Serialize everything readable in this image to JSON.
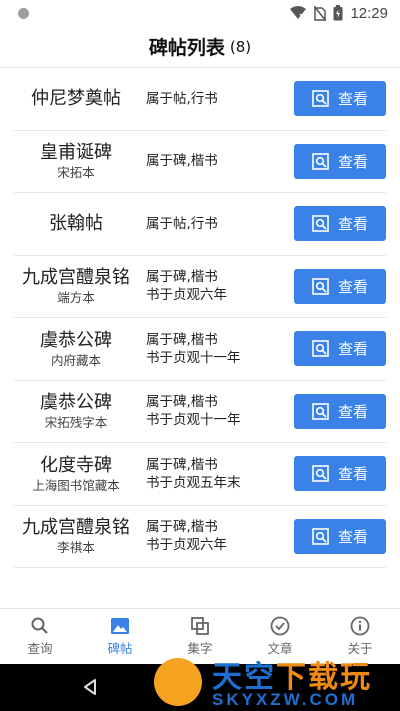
{
  "status": {
    "time": "12:29"
  },
  "header": {
    "title": "碑帖列表",
    "count": "(8)"
  },
  "items": [
    {
      "name": "仲尼梦奠帖",
      "edition": "",
      "info1": "属于帖,行书",
      "info2": "",
      "button": "查看"
    },
    {
      "name": "皇甫诞碑",
      "edition": "宋拓本",
      "info1": "属于碑,楷书",
      "info2": "",
      "button": "查看"
    },
    {
      "name": "张翰帖",
      "edition": "",
      "info1": "属于帖,行书",
      "info2": "",
      "button": "查看"
    },
    {
      "name": "九成宫醴泉铭",
      "edition": "端方本",
      "info1": "属于碑,楷书",
      "info2": "书于贞观六年",
      "button": "查看"
    },
    {
      "name": "虞恭公碑",
      "edition": "内府藏本",
      "info1": "属于碑,楷书",
      "info2": "书于贞观十一年",
      "button": "查看"
    },
    {
      "name": "虞恭公碑",
      "edition": "宋拓残字本",
      "info1": "属于碑,楷书",
      "info2": "书于贞观十一年",
      "button": "查看"
    },
    {
      "name": "化度寺碑",
      "edition": "上海图书馆藏本",
      "info1": "属于碑,楷书",
      "info2": "书于贞观五年末",
      "button": "查看"
    },
    {
      "name": "九成宫醴泉铭",
      "edition": "李祺本",
      "info1": "属于碑,楷书",
      "info2": "书于贞观六年",
      "button": "查看"
    }
  ],
  "tabs": [
    {
      "label": "查询",
      "icon": "search-icon"
    },
    {
      "label": "碑帖",
      "icon": "image-icon",
      "active": true
    },
    {
      "label": "集字",
      "icon": "copy-icon"
    },
    {
      "label": "文章",
      "icon": "check-circle-icon"
    },
    {
      "label": "关于",
      "icon": "info-icon"
    }
  ],
  "watermark": {
    "title_main": "天空",
    "title_accent": "下载玩",
    "subtitle": "SKYXZW.COM"
  },
  "colors": {
    "accent": "#3b82e8",
    "text": "#222222",
    "divider": "#e6e6e6"
  }
}
